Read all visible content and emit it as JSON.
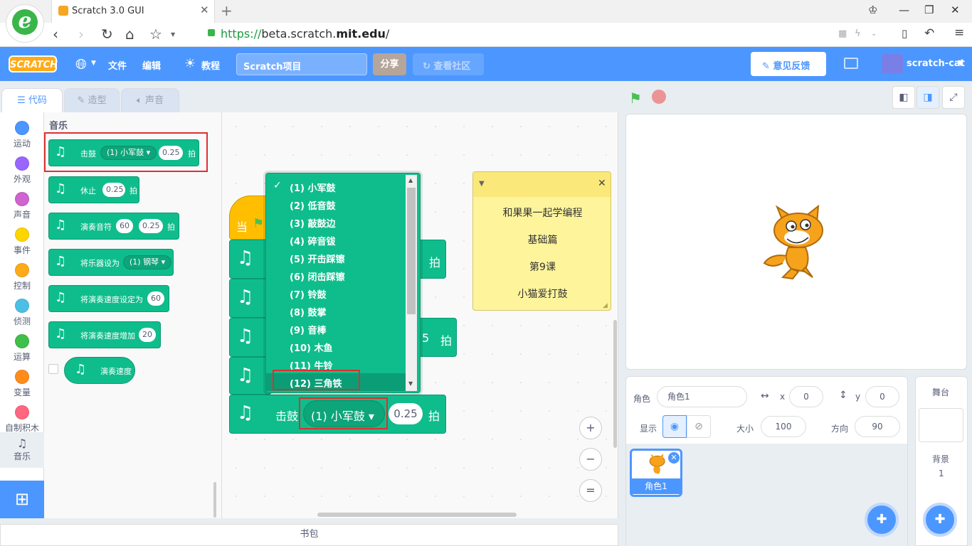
{
  "browser": {
    "tab_title": "Scratch 3.0 GUI",
    "new_tab": "+",
    "url_secure": "https://",
    "url_host": "beta.scratch.",
    "url_domain": "mit.edu",
    "url_path": "/"
  },
  "menubar": {
    "logo": "SCRATCH",
    "language_icon": "globe-icon",
    "file": "文件",
    "edit": "编辑",
    "tutorials": "教程",
    "project_title": "Scratch项目",
    "share": "分享",
    "see_community": "查看社区",
    "feedback": "意见反馈",
    "username": "scratch-cat"
  },
  "editor_tabs": {
    "code": "代码",
    "costumes": "造型",
    "sounds": "声音"
  },
  "categories": [
    {
      "label": "运动",
      "color": "#4c97ff"
    },
    {
      "label": "外观",
      "color": "#9966ff"
    },
    {
      "label": "声音",
      "color": "#cf63cf"
    },
    {
      "label": "事件",
      "color": "#ffd500"
    },
    {
      "label": "控制",
      "color": "#ffab19"
    },
    {
      "label": "侦测",
      "color": "#4cbfe6"
    },
    {
      "label": "运算",
      "color": "#40bf4a"
    },
    {
      "label": "变量",
      "color": "#ff8c1a"
    },
    {
      "label": "自制积木",
      "color": "#ff6680"
    },
    {
      "label": "音乐",
      "color": "#0fbd8c"
    }
  ],
  "palette": {
    "heading": "音乐",
    "blocks": {
      "play_drum": {
        "label": "击鼓",
        "drum": "(1) 小军鼓",
        "beats": "0.25",
        "unit": "拍"
      },
      "rest": {
        "label": "休止",
        "beats": "0.25",
        "unit": "拍"
      },
      "play_note": {
        "label": "演奏音符",
        "note": "60",
        "beats": "0.25",
        "unit": "拍"
      },
      "set_instrument": {
        "label": "将乐器设为",
        "instrument": "(1) 钢琴"
      },
      "set_tempo": {
        "label": "将演奏速度设定为",
        "value": "60"
      },
      "change_tempo": {
        "label": "将演奏速度增加",
        "value": "20"
      },
      "tempo": {
        "label": "演奏速度"
      }
    }
  },
  "workspace": {
    "hat_label": "当",
    "partial_unit_1": "拍",
    "partial_value_2": "5",
    "partial_unit_2": "拍",
    "main_block": {
      "label": "击鼓",
      "drum": "(1) 小军鼓",
      "beats": "0.25",
      "unit": "拍"
    },
    "dropdown_items": [
      "(1) 小军鼓",
      "(2) 低音鼓",
      "(3) 敲鼓边",
      "(4) 碎音钹",
      "(5) 开击踩镲",
      "(6) 闭击踩镲",
      "(7) 铃鼓",
      "(8) 鼓掌",
      "(9) 音棒",
      "(10) 木鱼",
      "(11) 牛铃",
      "(12) 三角铁"
    ],
    "dropdown_checked": "✓",
    "note": {
      "lines": [
        "和果果一起学编程",
        "基础篇",
        "第9课",
        "小猫爱打鼓"
      ]
    },
    "zoom_in": "+",
    "zoom_out": "−",
    "zoom_reset": "="
  },
  "backpack": "书包",
  "sprite_info": {
    "sprite_label": "角色",
    "sprite_name": "角色1",
    "x_label": "x",
    "x": "0",
    "y_label": "y",
    "y": "0",
    "show_label": "显示",
    "size_label": "大小",
    "size": "100",
    "direction_label": "方向",
    "direction": "90"
  },
  "sprites": [
    {
      "name": "角色1"
    }
  ],
  "stage_panel": {
    "title": "舞台",
    "backdrops_label": "背景",
    "backdrops_count": "1"
  }
}
